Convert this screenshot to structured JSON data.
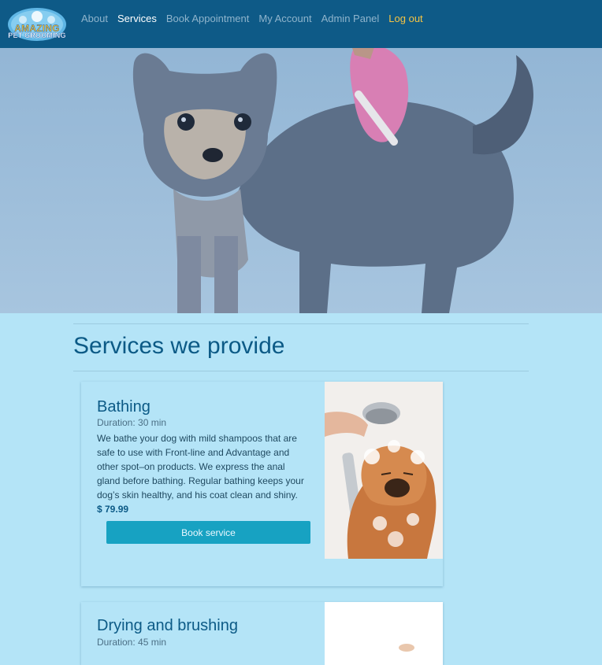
{
  "brand": {
    "logo_line1": "AMAZING",
    "logo_line2": "PET GROOMING"
  },
  "nav": {
    "items": [
      {
        "label": "About"
      },
      {
        "label": "Services"
      },
      {
        "label": "Book Appointment"
      },
      {
        "label": "My Account"
      },
      {
        "label": "Admin Panel"
      },
      {
        "label": "Log out"
      }
    ],
    "active": "Services"
  },
  "main": {
    "title": "Services we provide",
    "services": [
      {
        "name": "Bathing",
        "duration": "Duration: 30 min",
        "description": "We bathe your dog with mild shampoos that are safe to use with Front-line and Advantage and other spot–on products. We express the anal gland before bathing. Regular bathing keeps your dog’s skin healthy, and his coat clean and shiny.",
        "price": "$ 79.99",
        "button": "Book service"
      },
      {
        "name": "Drying and brushing",
        "duration": "Duration: 45 min"
      }
    ]
  },
  "colors": {
    "navbar": "#0e5a87",
    "page_bg": "#b4e4f7",
    "button": "#17a2c2",
    "logout_link": "#f6c443"
  }
}
